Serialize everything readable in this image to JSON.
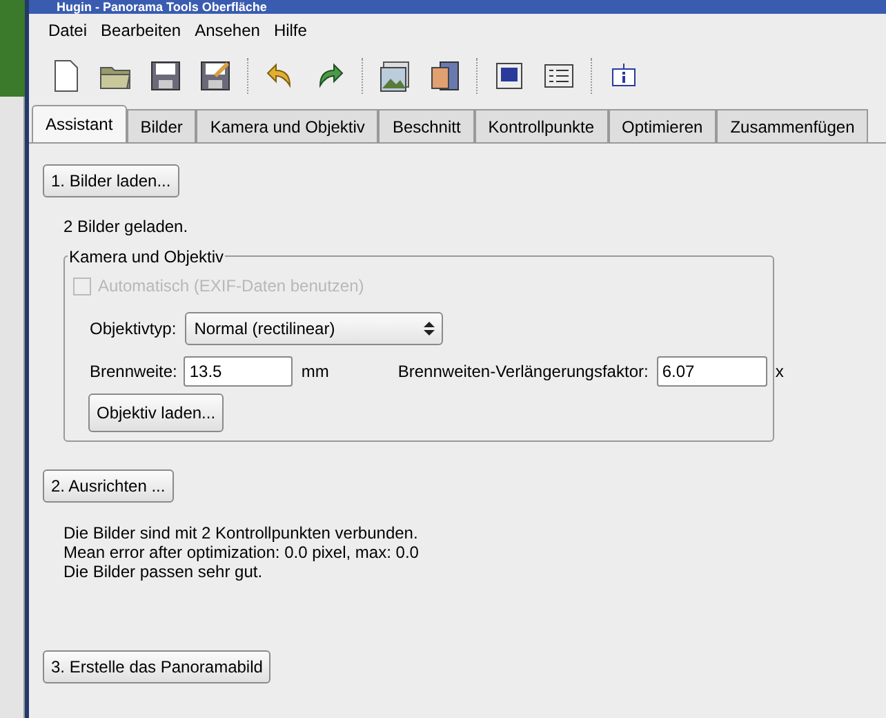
{
  "window": {
    "title": "Hugin - Panorama Tools Oberfläche"
  },
  "menu": [
    "Datei",
    "Bearbeiten",
    "Ansehen",
    "Hilfe"
  ],
  "toolbar": [
    {
      "kind": "new"
    },
    {
      "kind": "open"
    },
    {
      "kind": "save"
    },
    {
      "kind": "saveas"
    },
    {
      "kind": "sep"
    },
    {
      "kind": "undo"
    },
    {
      "kind": "redo"
    },
    {
      "kind": "sep"
    },
    {
      "kind": "images"
    },
    {
      "kind": "assist"
    },
    {
      "kind": "sep"
    },
    {
      "kind": "preview"
    },
    {
      "kind": "list"
    },
    {
      "kind": "sep"
    },
    {
      "kind": "info"
    }
  ],
  "tabs": [
    {
      "label": "Assistant",
      "selected": true
    },
    {
      "label": "Bilder",
      "selected": false
    },
    {
      "label": "Kamera und Objektiv",
      "selected": false
    },
    {
      "label": "Beschnitt",
      "selected": false
    },
    {
      "label": "Kontrollpunkte",
      "selected": false
    },
    {
      "label": "Optimieren",
      "selected": false
    },
    {
      "label": "Zusammenfügen",
      "selected": false
    }
  ],
  "load_button": "1. Bilder laden...",
  "load_status": "2 Bilder geladen.",
  "lens_group": {
    "title": "Kamera und Objektiv",
    "auto_checkbox": {
      "label": "Automatisch (EXIF-Daten benutzen)",
      "checked": false,
      "disabled": true
    },
    "lens_type_label": "Objektivtyp:",
    "lens_type": "Normal (rectilinear)",
    "focal_label": "Brennweite:",
    "focal_value": "13.5",
    "focal_unit": "mm",
    "crop_label": "Brennweiten-Verlängerungsfaktor:",
    "crop_value": "6.07",
    "crop_unit": "x",
    "load_lens_button": "Objektiv laden..."
  },
  "align_button": "2. Ausrichten ...",
  "align_status": [
    "Die Bilder sind mit 2 Kontrollpunkten verbunden.",
    "Mean error after optimization: 0.0 pixel, max: 0.0",
    "Die Bilder passen sehr gut."
  ],
  "create_button": "3. Erstelle das Panoramabild"
}
